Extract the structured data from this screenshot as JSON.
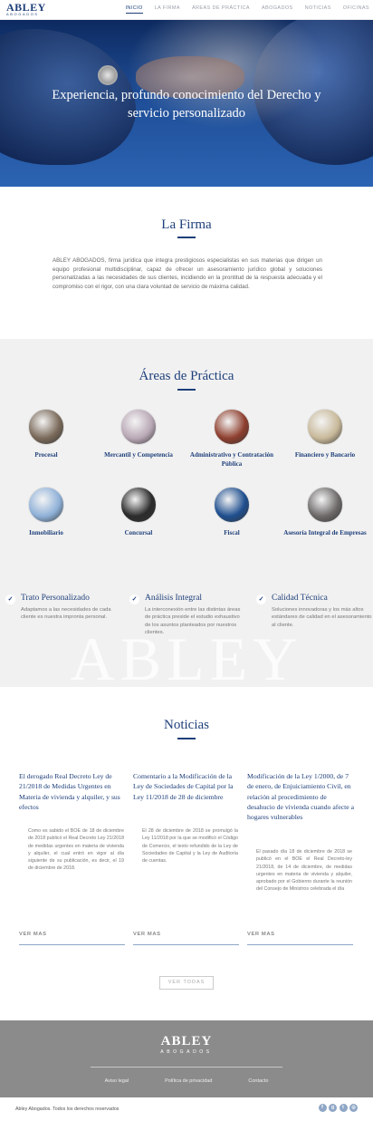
{
  "header": {
    "logo_main": "ABLEY",
    "logo_sub": "ABOGADOS",
    "nav": [
      "INICIO",
      "LA FIRMA",
      "ÁREAS DE PRÁCTICA",
      "ABOGADOS",
      "NOTICIAS",
      "OFICINAS"
    ]
  },
  "hero": {
    "title_line1": "Experiencia, profundo conocimiento del Derecho y",
    "title_line2": "servicio personalizado"
  },
  "firma": {
    "title": "La Firma",
    "text": "ABLEY ABOGADOS, firma jurídica que integra prestigiosos especialistas en sus materias que dirigen un equipo profesional multidisciplinar, capaz de ofrecer un asesoramiento jurídico global y soluciones personalizadas a las necesidades de sus clientes, incidiendo en la prontitud de la respuesta adecuada y el compromiso con el rigor, con una clara voluntad de servicio de máxima calidad."
  },
  "areas": {
    "title": "Áreas de Práctica",
    "items": [
      {
        "label": "Procesal",
        "icon": "gavel-image",
        "color": "#7a6a5a"
      },
      {
        "label": "Mercantil y Competencia",
        "icon": "pen-document-image",
        "color": "#b9a8b6"
      },
      {
        "label": "Administrativo y Contratación Pública",
        "icon": "books-image",
        "color": "#8e3f2e"
      },
      {
        "label": "Financiero y Bancario",
        "icon": "coins-image",
        "color": "#c8b99a"
      },
      {
        "label": "Inmobiliario",
        "icon": "building-image",
        "color": "#8fb1d8"
      },
      {
        "label": "Concursal",
        "icon": "pen-image",
        "color": "#2b2b2b"
      },
      {
        "label": "Fiscal",
        "icon": "circuit-image",
        "color": "#1f4f8f"
      },
      {
        "label": "Asesoría Integral de Empresas",
        "icon": "laptop-image",
        "color": "#6d6a69"
      }
    ],
    "watermark": "ABLEY"
  },
  "features": [
    {
      "title": "Trato Personalizado",
      "text": "Adaptamos a las necesidades de cada cliente es nuestra impronta personal."
    },
    {
      "title": "Análisis Integral",
      "text": "La interconexión entre las distintas áreas de práctica preside el estudio exhaustivo de los asuntos planteados por nuestros clientes."
    },
    {
      "title": "Calidad Técnica",
      "text": "Soluciones innovadoras y los más altos estándares de calidad en el asesoramiento al cliente."
    }
  ],
  "news": {
    "title": "Noticias",
    "items": [
      {
        "title": "El derogado Real Decreto Ley de 21/2018 de Medidas Urgentes en Materia de vivienda y alquiler, y sus efectos",
        "body": "Como es sabido el BOE de 18 de diciembre de 2018 publicó el Real Decreto Ley 21/2018 de medidas urgentes en materia de vivienda y alquiler, el cual entró en vigor al día siguiente de su publicación, es decir, el 19 de diciembre de 2018.",
        "more": "VER MAS"
      },
      {
        "title": "Comentario a la Modificación de la Ley de Sociedades de Capital por la Ley 11/2018 de 28 de diciembre",
        "body": "El 28 de diciembre de 2018 se promulgó la Ley 11/2018 por la que se modificó el Código de Comercio, el texto refundido de la Ley de Sociedades de Capital y la Ley de Auditoría de cuentas.",
        "more": "VER MAS"
      },
      {
        "title": "Modificación de la Ley 1/2000, de 7 de enero, de Enjuiciamiento Civil, en relación al procedimiento de desahucio de vivienda cuando afecte a hogares vulnerables",
        "body": "El pasado día 18 de diciembre de 2018 se publicó en el BOE el Real Decreto-ley 21/2018, de 14 de diciembre, de medidas urgentes en materia de vivienda y alquiler, aprobado por el Gobierno durante la reunión del Consejo de Ministros celebrada el día",
        "more": "VER MAS"
      }
    ],
    "view_all": "VER TODAS"
  },
  "footer": {
    "logo_main": "ABLEY",
    "logo_sub": "ABOGADOS",
    "links": [
      "Aviso legal",
      "Política de privacidad",
      "Contacto"
    ],
    "copyright": "Abley Abogados. Todos los derechos reservados",
    "socials": [
      {
        "name": "facebook-icon",
        "glyph": "f"
      },
      {
        "name": "google-plus-icon",
        "glyph": "g"
      },
      {
        "name": "twitter-icon",
        "glyph": "t"
      },
      {
        "name": "instagram-icon",
        "glyph": "◎"
      }
    ]
  }
}
